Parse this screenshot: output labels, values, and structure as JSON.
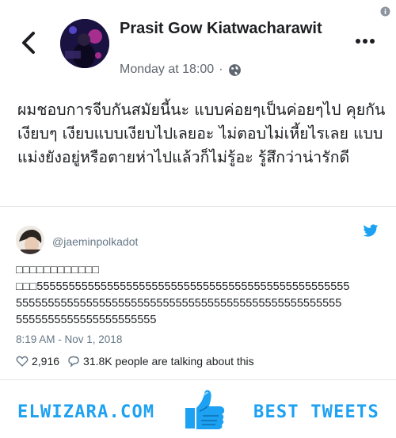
{
  "post": {
    "author_name": "Prasit Gow Kiatwacharawit",
    "timestamp": "Monday at 18:00",
    "separator": "·",
    "body": "ผมชอบการจีบกันสมัยนี้นะ แบบค่อยๆเป็นค่อยๆไป คุยกันเงียบๆ เงียบแบบเงียบไปเลยอะ ไม่ตอบไม่เหี้ยไรเลย แบบแม่งยังอยู่หรือตายห่าไปแล้วก็ไม่รู้อะ รู้สึกว่าน่ารักดี"
  },
  "tweet": {
    "handle": "@jaeminpolkadot",
    "line1": "□□□□□□□□□□□□",
    "line2": "□□□5555555555555555555555555555555555555555555555555",
    "line3": "555555555555555555555555555555555555555555555555555",
    "line4": "5555555555555555555555",
    "time": "8:19 AM - Nov 1, 2018",
    "likes": "2,916",
    "talking": "31.8K people are talking about this"
  },
  "footer": {
    "brand_left": "ELWIZARA.COM",
    "brand_right": "BEST TWEETS"
  },
  "icons": {
    "back": "chevron-left-icon",
    "more": "more-dots-icon",
    "globe": "globe-icon",
    "info": "info-icon",
    "twitter": "twitter-bird-icon",
    "heart": "heart-icon",
    "reply": "speech-bubble-icon",
    "thumb": "thumbs-up-icon"
  },
  "colors": {
    "twitter_blue": "#1da1f2",
    "text": "#1c1e21",
    "muted": "#606770"
  }
}
